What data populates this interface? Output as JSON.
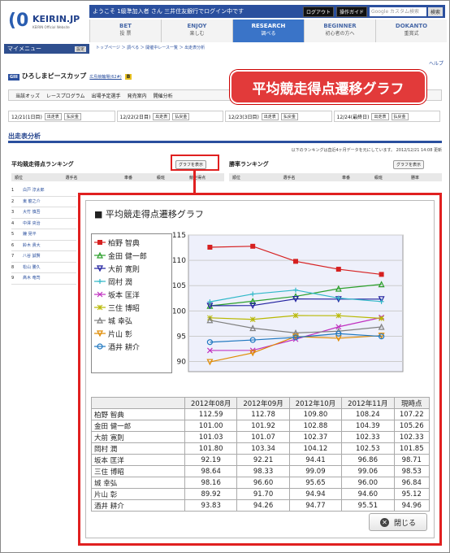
{
  "header": {
    "logo_mark": "(0",
    "logo_name": "KEIRIN.JP",
    "logo_sub": "KEIRIN Official Website",
    "welcome": "ようこそ 1級準加入者 さん 三井住友銀行でログイン中です",
    "logout": "ログアウト",
    "guide": "操作ガイド",
    "search_placeholder": "Google カスタム検索",
    "search_button": "検索"
  },
  "nav": [
    {
      "en": "BET",
      "ja": "投 票"
    },
    {
      "en": "ENJOY",
      "ja": "楽しむ"
    },
    {
      "en": "RESEARCH",
      "ja": "調べる"
    },
    {
      "en": "BEGINNER",
      "ja": "初心者の方へ"
    },
    {
      "en": "DOKANTO",
      "ja": "重賞式"
    }
  ],
  "mymenu": {
    "label": "マイメニュー",
    "setting": "設定"
  },
  "breadcrumb": "トップページ ＞ 調べる ＞ 開催中レース一覧 ＞ 出走表分析",
  "help": "ヘルプ",
  "race": {
    "grade": "GIII",
    "name": "ひろしまピースカップ",
    "link": "広島競輪場(62#)",
    "badge": "B"
  },
  "subnav": [
    "当該オッズ",
    "レースプログラム",
    "出場予定選手",
    "発売案内",
    "開催分析"
  ],
  "days": [
    {
      "label": "12/21(1日目)",
      "b1": "出走表",
      "b2": "払戻金"
    },
    {
      "label": "12/22(2日目)",
      "b1": "出走表",
      "b2": "払戻金"
    },
    {
      "label": "12/23(3日目)",
      "b1": "出走表",
      "b2": "払戻金"
    },
    {
      "label": "12/24(最終日)",
      "b1": "出走表",
      "b2": "払戻金"
    }
  ],
  "section_title": "出走表分析",
  "note": "以下のランキングは直近4ヶ月データを元にしています。 2012/12/21 14:08 更新",
  "rank_left": "平均競走得点ランキング",
  "rank_right": "勝率ランキング",
  "graph_button": "グラフを表示",
  "thead_left": [
    "順位",
    "選手名",
    "車番",
    "級班",
    "競走得点"
  ],
  "thead_right": [
    "順位",
    "選手名",
    "車番",
    "級班",
    "勝率"
  ],
  "bg_names": [
    "白戸 淳太郎",
    "東 龍之介",
    "大竹 慎吾",
    "中澤 央治",
    "鐘 晃平",
    "鈴木 貴大",
    "八谷 誠賢",
    "松山 勝久",
    "髙木 竜司"
  ],
  "callout": "平均競走得点遷移グラフ",
  "popup": {
    "title": "■ 平均競走得点遷移グラフ",
    "close": "閉じる"
  },
  "chart_data": {
    "type": "line",
    "title": "平均競走得点遷移グラフ",
    "categories": [
      "2012年08月",
      "2012年09月",
      "2012年10月",
      "2012年11月",
      "現時点"
    ],
    "ylim": [
      88,
      115
    ],
    "yticks": [
      90,
      95,
      100,
      105,
      110,
      115
    ],
    "series": [
      {
        "name": "柏野 智典",
        "color": "#d62020",
        "marker": "square",
        "values": [
          112.59,
          112.78,
          109.8,
          108.24,
          107.22
        ]
      },
      {
        "name": "金田 健一郎",
        "color": "#2ca02c",
        "marker": "triangle",
        "values": [
          101.0,
          101.92,
          102.88,
          104.39,
          105.26
        ]
      },
      {
        "name": "大前 寛則",
        "color": "#1f1f9e",
        "marker": "tri-down",
        "values": [
          101.03,
          101.07,
          102.37,
          102.33,
          102.33
        ]
      },
      {
        "name": "岡村 潤",
        "color": "#30b8c8",
        "marker": "plus",
        "values": [
          101.8,
          103.34,
          104.12,
          102.53,
          101.85
        ]
      },
      {
        "name": "坂本 匡洋",
        "color": "#c030c0",
        "marker": "x",
        "values": [
          92.19,
          92.21,
          94.41,
          96.86,
          98.71
        ]
      },
      {
        "name": "三住 博昭",
        "color": "#b8b800",
        "marker": "star",
        "values": [
          98.64,
          98.33,
          99.09,
          99.06,
          98.53
        ]
      },
      {
        "name": "城 幸弘",
        "color": "#808080",
        "marker": "triangle",
        "values": [
          98.16,
          96.6,
          95.65,
          96.0,
          96.84
        ]
      },
      {
        "name": "片山 彰",
        "color": "#e08a00",
        "marker": "tri-down",
        "values": [
          89.92,
          91.7,
          94.94,
          94.6,
          95.12
        ]
      },
      {
        "name": "酒井 耕介",
        "color": "#2078c0",
        "marker": "circle",
        "values": [
          93.83,
          94.26,
          94.77,
          95.51,
          94.96
        ]
      }
    ]
  },
  "table": {
    "headers": [
      "",
      "2012年08月",
      "2012年09月",
      "2012年10月",
      "2012年11月",
      "現時点"
    ],
    "rows": [
      [
        "柏野 智典",
        "112.59",
        "112.78",
        "109.80",
        "108.24",
        "107.22"
      ],
      [
        "金田 健一郎",
        "101.00",
        "101.92",
        "102.88",
        "104.39",
        "105.26"
      ],
      [
        "大前 寛則",
        "101.03",
        "101.07",
        "102.37",
        "102.33",
        "102.33"
      ],
      [
        "岡村 潤",
        "101.80",
        "103.34",
        "104.12",
        "102.53",
        "101.85"
      ],
      [
        "坂本 匡洋",
        "92.19",
        "92.21",
        "94.41",
        "96.86",
        "98.71"
      ],
      [
        "三住 博昭",
        "98.64",
        "98.33",
        "99.09",
        "99.06",
        "98.53"
      ],
      [
        "城 幸弘",
        "98.16",
        "96.60",
        "95.65",
        "96.00",
        "96.84"
      ],
      [
        "片山 彰",
        "89.92",
        "91.70",
        "94.94",
        "94.60",
        "95.12"
      ],
      [
        "酒井 耕介",
        "93.83",
        "94.26",
        "94.77",
        "95.51",
        "94.96"
      ]
    ]
  }
}
